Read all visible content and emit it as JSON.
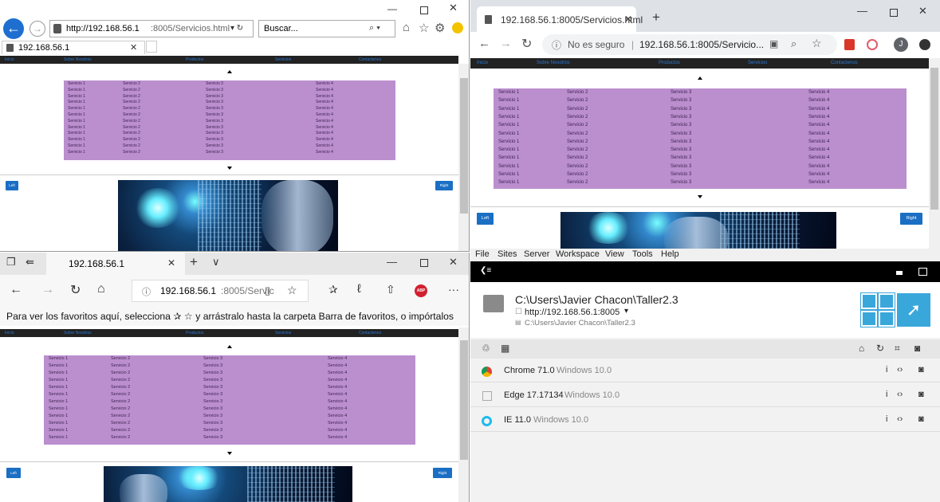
{
  "site": {
    "nav": [
      "Inicio",
      "Sobre Nosotros",
      "Productos",
      "Servicios",
      "Contactenos"
    ],
    "services": [
      "Servicio 1",
      "Servicio 2",
      "Servicio 3",
      "Servicio 4"
    ],
    "row_count": 12,
    "left_button": "Left",
    "right_button": "Right"
  },
  "ie": {
    "url_host": "http://192.168.56.1",
    "url_path": ":8005/Servicios.html",
    "search_placeholder": "Buscar...",
    "tab_title": "192.168.56.1"
  },
  "chrome": {
    "tab_title": "192.168.56.1:8005/Servicios.html",
    "not_secure": "No es seguro",
    "url": "192.168.56.1:8005/Servicio...",
    "avatar": "J"
  },
  "edge": {
    "tab_title": "192.168.56.1",
    "url_host": "192.168.56.1",
    "url_path": ":8005/Servic",
    "favorites_hint": "Para ver los favoritos aquí, selecciona ✰ ☆ y arrástralo hasta la carpeta Barra de favoritos, o impórtalos",
    "abp": "ABP"
  },
  "browsersync": {
    "menu": [
      "File",
      "Sites",
      "Server",
      "Workspace",
      "View",
      "Tools",
      "Help"
    ],
    "project_path": "C:\\Users\\Javier Chacon\\Taller2.3",
    "server_url": "http://192.168.56.1:8005",
    "local_path": "C:\\Users\\Javier Chacon\\Taller2.3",
    "devices": [
      {
        "name": "Chrome 71.0",
        "os": "Windows 10.0"
      },
      {
        "name": "Edge 17.17134",
        "os": "Windows 10.0"
      },
      {
        "name": "IE 11.0",
        "os": "Windows 10.0"
      }
    ]
  },
  "colors": {
    "service_bg": "#bb8fce",
    "nav_bg": "#222222",
    "button_blue": "#1a6fc4",
    "bs_blue": "#3aa7db"
  }
}
